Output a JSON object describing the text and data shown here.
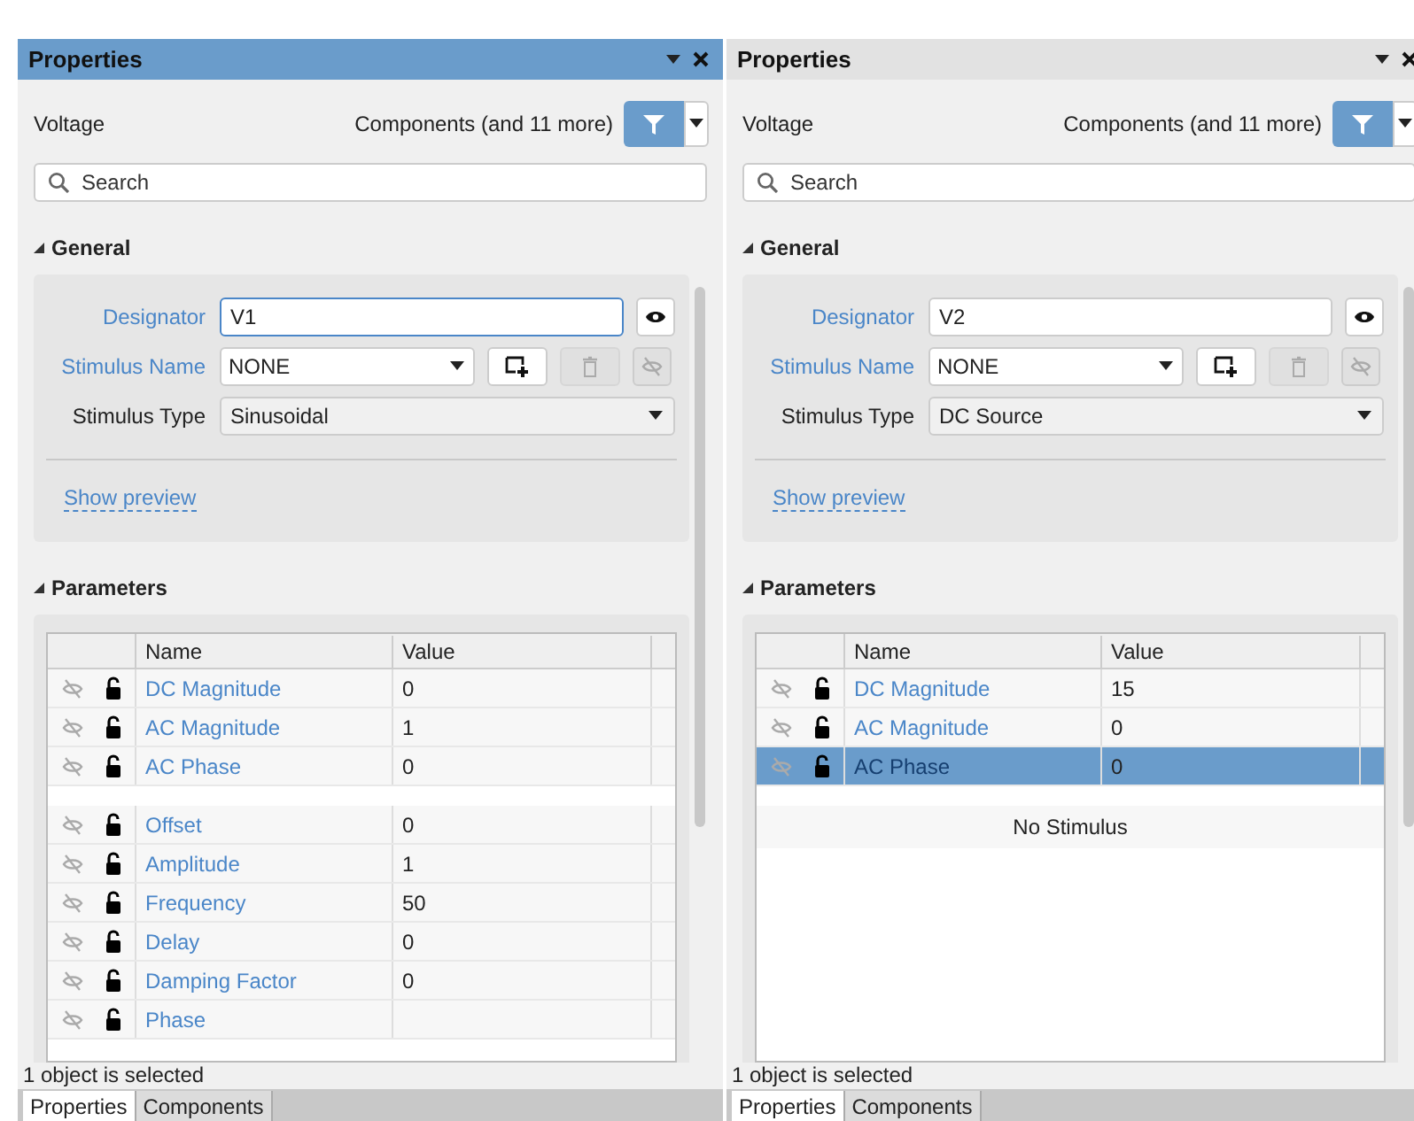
{
  "panels": [
    {
      "title": "Properties",
      "active": true,
      "object_type": "Voltage",
      "filter_label": "Components (and 11 more)",
      "search": {
        "placeholder": "Search"
      },
      "general": {
        "header": "General",
        "designator_label": "Designator",
        "designator": "V1",
        "designator_focused": true,
        "stimulus_name_label": "Stimulus Name",
        "stimulus_name": "NONE",
        "stimulus_type_label": "Stimulus Type",
        "stimulus_type": "Sinusoidal",
        "show_preview": "Show preview"
      },
      "parameters": {
        "header": "Parameters",
        "columns": [
          "Name",
          "Value"
        ],
        "groups": [
          [
            {
              "name": "DC Magnitude",
              "value": "0",
              "selected": false
            },
            {
              "name": "AC Magnitude",
              "value": "1",
              "selected": false
            },
            {
              "name": "AC Phase",
              "value": "0",
              "selected": false
            }
          ],
          [
            {
              "name": "Offset",
              "value": "0",
              "selected": false
            },
            {
              "name": "Amplitude",
              "value": "1",
              "selected": false
            },
            {
              "name": "Frequency",
              "value": "50",
              "selected": false
            },
            {
              "name": "Delay",
              "value": "0",
              "selected": false
            },
            {
              "name": "Damping Factor",
              "value": "0",
              "selected": false
            },
            {
              "name": "Phase",
              "selected": false
            }
          ]
        ]
      },
      "status": "1 object is selected",
      "tabs": [
        {
          "label": "Properties",
          "selected": true
        },
        {
          "label": "Components",
          "selected": false
        }
      ]
    },
    {
      "title": "Properties",
      "active": false,
      "object_type": "Voltage",
      "filter_label": "Components (and 11 more)",
      "search": {
        "placeholder": "Search"
      },
      "general": {
        "header": "General",
        "designator_label": "Designator",
        "designator": "V2",
        "designator_focused": false,
        "stimulus_name_label": "Stimulus Name",
        "stimulus_name": "NONE",
        "stimulus_type_label": "Stimulus Type",
        "stimulus_type": "DC Source",
        "show_preview": "Show preview"
      },
      "parameters": {
        "header": "Parameters",
        "columns": [
          "Name",
          "Value"
        ],
        "groups": [
          [
            {
              "name": "DC Magnitude",
              "value": "15",
              "selected": false
            },
            {
              "name": "AC Magnitude",
              "value": "0",
              "selected": false
            },
            {
              "name": "AC Phase",
              "value": "0",
              "selected": true
            }
          ]
        ],
        "empty_message": "No Stimulus"
      },
      "status": "1 object is selected",
      "tabs": [
        {
          "label": "Properties",
          "selected": true
        },
        {
          "label": "Components",
          "selected": false
        }
      ]
    }
  ]
}
